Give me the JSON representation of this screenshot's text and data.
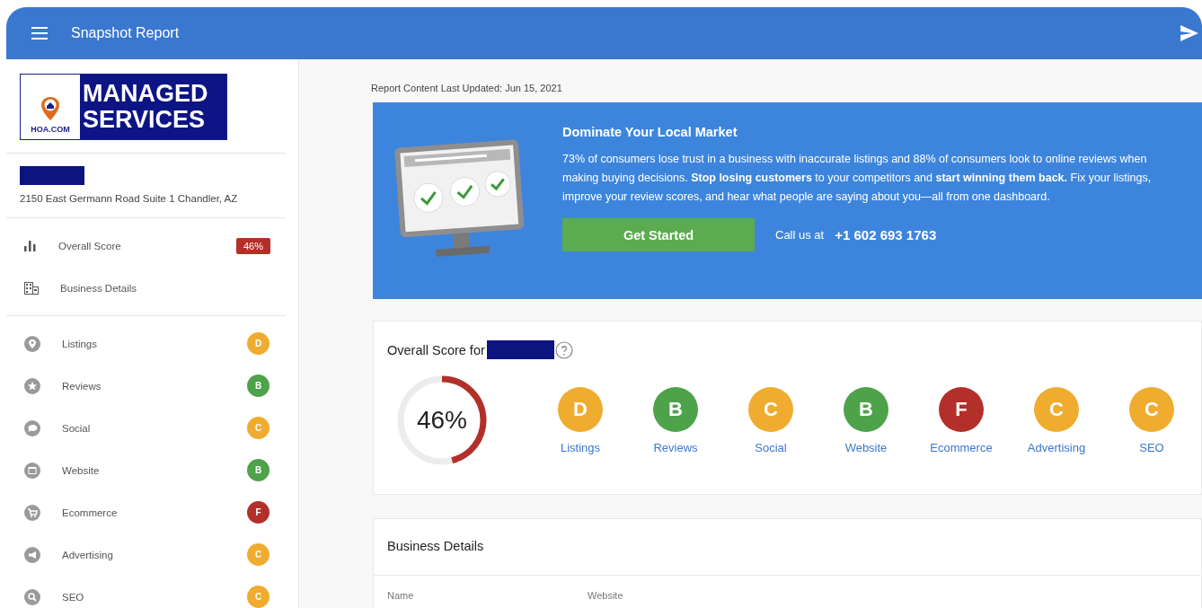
{
  "app_bar": {
    "title": "Snapshot Report"
  },
  "sidebar": {
    "logo": {
      "small_text": "HOA.COM",
      "line_1": "MANAGED",
      "line_2": "SERVICES"
    },
    "address": "2150 East Germann Road Suite 1 Chandler, AZ",
    "nav_top": [
      {
        "label": "Overall Score",
        "kind": "score",
        "badge": "46%"
      },
      {
        "label": "Business Details",
        "kind": "details"
      }
    ],
    "nav_grades": [
      {
        "label": "Listings",
        "grade": "D",
        "color": "#f0ac2e"
      },
      {
        "label": "Reviews",
        "grade": "B",
        "color": "#4ea24a"
      },
      {
        "label": "Social",
        "grade": "C",
        "color": "#f0ac2e"
      },
      {
        "label": "Website",
        "grade": "B",
        "color": "#4ea24a"
      },
      {
        "label": "Ecommerce",
        "grade": "F",
        "color": "#b3302a"
      },
      {
        "label": "Advertising",
        "grade": "C",
        "color": "#f0ac2e"
      },
      {
        "label": "SEO",
        "grade": "C",
        "color": "#f0ac2e"
      }
    ]
  },
  "main": {
    "updated": "Report Content Last Updated: Jun 15, 2021",
    "banner": {
      "title": "Dominate Your Local Market",
      "text": "73% of consumers lose trust in a business with inaccurate listings and 88% of consumers look to online reviews when making buying decisions. **Stop losing customers** to your competitors and **start winning them back.** Fix your listings, improve your review scores, and hear what people are saying about you—all from one dashboard.",
      "button": "Get Started",
      "call_label": "Call us at",
      "phone": "+1 602 693 1763"
    },
    "score_card": {
      "title": "Overall Score for",
      "score": "46%",
      "level": 0.46,
      "grades": [
        {
          "label": "Listings",
          "grade": "D",
          "color": "#f0ac2e"
        },
        {
          "label": "Reviews",
          "grade": "B",
          "color": "#4ea24a"
        },
        {
          "label": "Social",
          "grade": "C",
          "color": "#f0ac2e"
        },
        {
          "label": "Website",
          "grade": "B",
          "color": "#4ea24a"
        },
        {
          "label": "Ecommerce",
          "grade": "F",
          "color": "#b3302a"
        },
        {
          "label": "Advertising",
          "grade": "C",
          "color": "#f0ac2e"
        },
        {
          "label": "SEO",
          "grade": "C",
          "color": "#f0ac2e"
        }
      ]
    },
    "details_card": {
      "title": "Business Details",
      "columns": [
        "Name",
        "Website"
      ]
    }
  }
}
